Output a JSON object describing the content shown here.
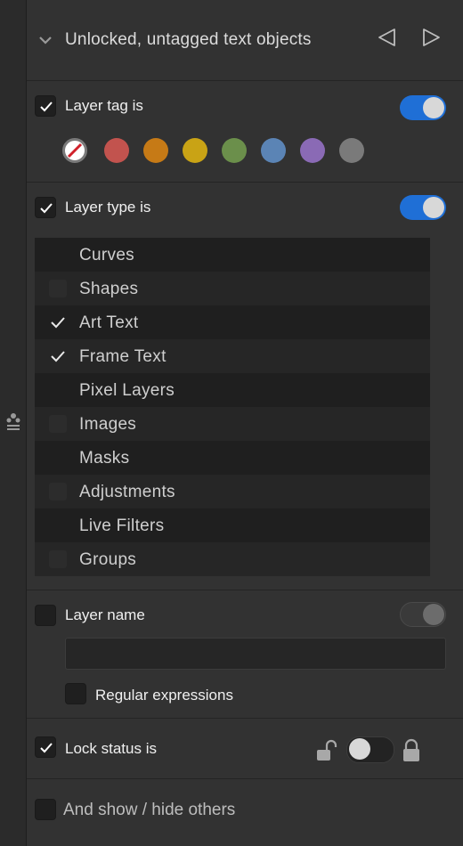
{
  "header": {
    "title": "Unlocked, untagged text objects",
    "chevron_icon": "chevron-down-icon",
    "prev_icon": "triangle-left-icon",
    "next_icon": "triangle-right-icon"
  },
  "layer_tag": {
    "label": "Layer tag is",
    "checked": true,
    "toggle_on": true,
    "tags": [
      {
        "name": "none",
        "color": "#ffffff",
        "selected": true
      },
      {
        "name": "red",
        "color": "#c2534e"
      },
      {
        "name": "orange",
        "color": "#c67a16"
      },
      {
        "name": "yellow",
        "color": "#c9a315"
      },
      {
        "name": "green",
        "color": "#6b8f4b"
      },
      {
        "name": "blue",
        "color": "#5b84b5"
      },
      {
        "name": "purple",
        "color": "#8a6ab5"
      },
      {
        "name": "gray",
        "color": "#7a7a7a"
      }
    ]
  },
  "layer_type": {
    "label": "Layer type is",
    "checked": true,
    "toggle_on": true,
    "types": [
      {
        "label": "Curves",
        "checked": false
      },
      {
        "label": "Shapes",
        "checked": false
      },
      {
        "label": "Art Text",
        "checked": true
      },
      {
        "label": "Frame Text",
        "checked": true
      },
      {
        "label": "Pixel Layers",
        "checked": false
      },
      {
        "label": "Images",
        "checked": false
      },
      {
        "label": "Masks",
        "checked": false
      },
      {
        "label": "Adjustments",
        "checked": false
      },
      {
        "label": "Live Filters",
        "checked": false
      },
      {
        "label": "Groups",
        "checked": false
      }
    ]
  },
  "layer_name": {
    "label": "Layer name",
    "checked": false,
    "value": "",
    "regex_label": "Regular expressions",
    "regex_checked": false
  },
  "lock_status": {
    "label": "Lock status is",
    "checked": true,
    "unlocked_icon": "unlocked-padlock-icon",
    "locked_icon": "locked-padlock-icon"
  },
  "show_hide": {
    "label": "And show / hide others",
    "checked": false
  },
  "rail": {
    "icon": "people-icon"
  },
  "colors": {
    "accent": "#1f6fd6",
    "panel_bg": "#323232",
    "list_bg": "#1f1f1f"
  }
}
